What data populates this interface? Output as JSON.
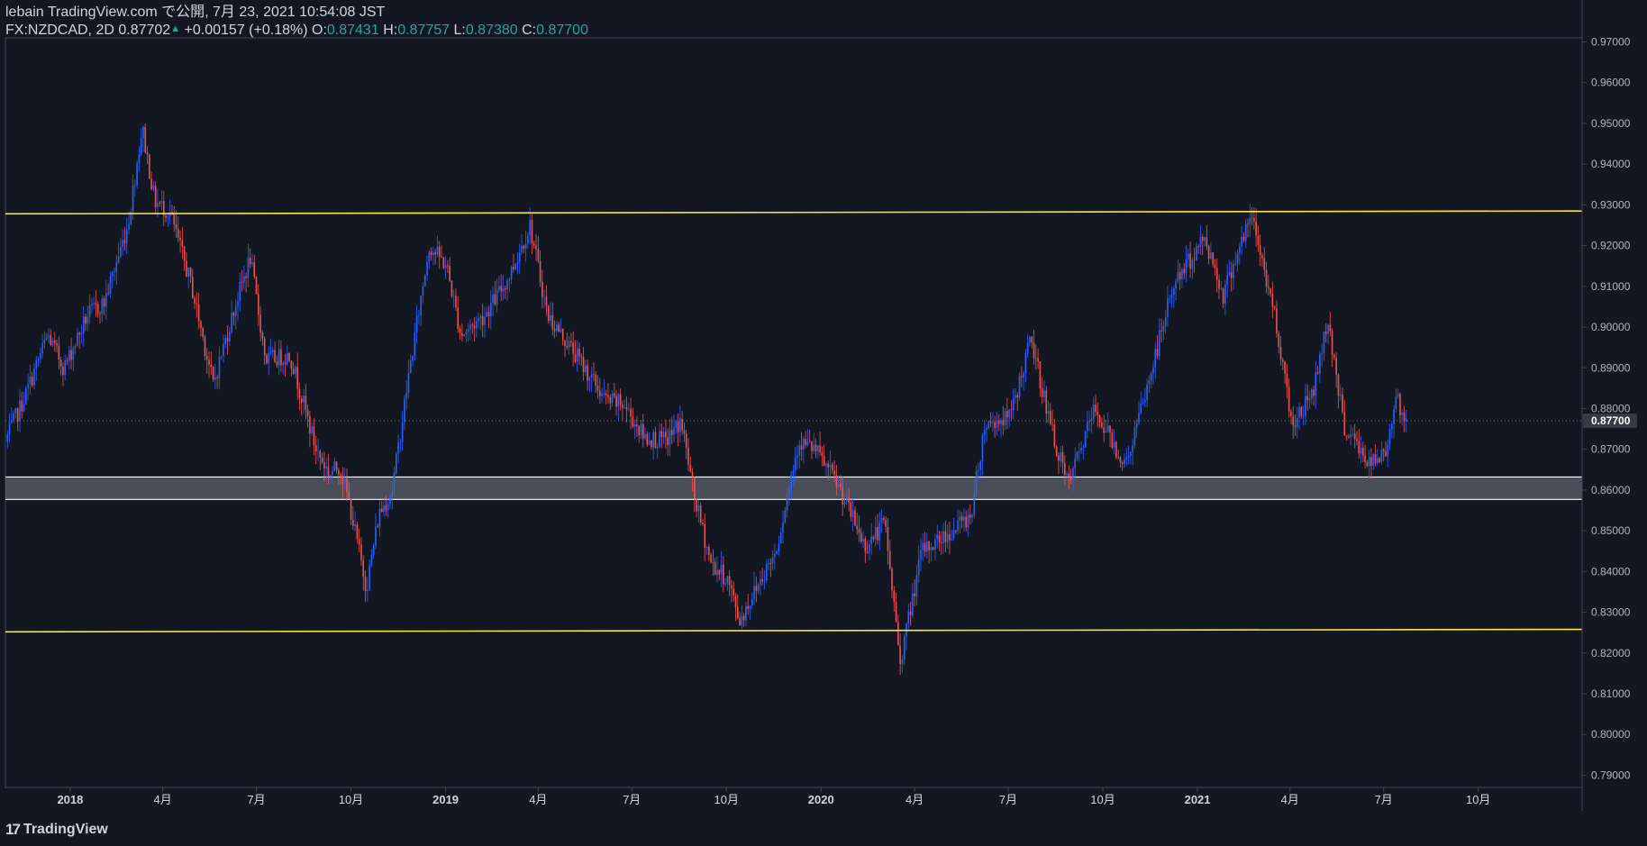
{
  "header": {
    "published": "lebain TradingView.com で公開, 7月 23, 2021 10:54:08 JST",
    "symbol": "FX:NZDCAD, 2D",
    "last": "0.87702",
    "change": "+0.00157 (+0.18%)",
    "o_label": "O:",
    "o_value": "0.87431",
    "h_label": "H:",
    "h_value": "0.87757",
    "l_label": "L:",
    "l_value": "0.87380",
    "c_label": "C:",
    "c_value": "0.87700"
  },
  "footer": {
    "brand": "TradingView",
    "logo_icon": "tradingview-logo-icon"
  },
  "colors": {
    "background": "#131722",
    "up": "#2962ff",
    "down": "#ef5350",
    "level_line": "#f5e643",
    "zone_fill": "#787b86",
    "zone_border": "#ffffff",
    "axis_text": "#b2b5be",
    "last_price_bg": "#363a45"
  },
  "chart_data": {
    "type": "candlestick",
    "ylim": [
      0.787,
      0.971
    ],
    "y_ticks": [
      "0.97000",
      "0.96000",
      "0.95000",
      "0.94000",
      "0.93000",
      "0.92000",
      "0.91000",
      "0.90000",
      "0.89000",
      "0.88000",
      "0.87000",
      "0.86000",
      "0.85000",
      "0.84000",
      "0.83000",
      "0.82000",
      "0.81000",
      "0.80000",
      "0.79000"
    ],
    "x_ticks": [
      {
        "label": "2018",
        "bold": true,
        "date": "2018-01-01"
      },
      {
        "label": "4月",
        "bold": false,
        "date": "2018-04-01"
      },
      {
        "label": "7月",
        "bold": false,
        "date": "2018-07-01"
      },
      {
        "label": "10月",
        "bold": false,
        "date": "2018-10-01"
      },
      {
        "label": "2019",
        "bold": true,
        "date": "2019-01-01"
      },
      {
        "label": "4月",
        "bold": false,
        "date": "2019-04-01"
      },
      {
        "label": "7月",
        "bold": false,
        "date": "2019-07-01"
      },
      {
        "label": "10月",
        "bold": false,
        "date": "2019-10-01"
      },
      {
        "label": "2020",
        "bold": true,
        "date": "2020-01-01"
      },
      {
        "label": "4月",
        "bold": false,
        "date": "2020-04-01"
      },
      {
        "label": "7月",
        "bold": false,
        "date": "2020-07-01"
      },
      {
        "label": "10月",
        "bold": false,
        "date": "2020-10-01"
      },
      {
        "label": "2021",
        "bold": true,
        "date": "2021-01-01"
      },
      {
        "label": "4月",
        "bold": false,
        "date": "2021-04-01"
      },
      {
        "label": "7月",
        "bold": false,
        "date": "2021-07-01"
      },
      {
        "label": "10月",
        "bold": false,
        "date": "2021-10-01"
      }
    ],
    "x_range": [
      "2017-10-30",
      "2022-01-10"
    ],
    "last_price_label": "0.87700",
    "last_price": 0.877,
    "horizontal_lines": [
      {
        "name": "upper-resistance",
        "start": {
          "date": "2017-10-30",
          "value": 0.9278
        },
        "end": {
          "date": "2022-01-10",
          "value": 0.9285
        }
      },
      {
        "name": "lower-support",
        "start": {
          "date": "2017-10-30",
          "value": 0.8252
        },
        "end": {
          "date": "2022-01-10",
          "value": 0.8258
        }
      }
    ],
    "zone": {
      "top": 0.8632,
      "bottom": 0.8577,
      "start": "2017-10-30",
      "end": "2022-01-10"
    },
    "candles_generated": true,
    "candle_start": "2017-11-01",
    "candle_end": "2021-07-23",
    "candle_interval_days": 2,
    "anchors": [
      {
        "date": "2017-11-01",
        "value": 0.872
      },
      {
        "date": "2017-11-20",
        "value": 0.883
      },
      {
        "date": "2017-12-12",
        "value": 0.898
      },
      {
        "date": "2017-12-28",
        "value": 0.89
      },
      {
        "date": "2018-01-20",
        "value": 0.903
      },
      {
        "date": "2018-02-05",
        "value": 0.906
      },
      {
        "date": "2018-02-28",
        "value": 0.925
      },
      {
        "date": "2018-03-14",
        "value": 0.949
      },
      {
        "date": "2018-03-26",
        "value": 0.931
      },
      {
        "date": "2018-04-10",
        "value": 0.928
      },
      {
        "date": "2018-05-01",
        "value": 0.91
      },
      {
        "date": "2018-05-22",
        "value": 0.886
      },
      {
        "date": "2018-06-12",
        "value": 0.905
      },
      {
        "date": "2018-06-27",
        "value": 0.917
      },
      {
        "date": "2018-07-12",
        "value": 0.892
      },
      {
        "date": "2018-08-05",
        "value": 0.893
      },
      {
        "date": "2018-08-30",
        "value": 0.87
      },
      {
        "date": "2018-09-12",
        "value": 0.864
      },
      {
        "date": "2018-09-22",
        "value": 0.866
      },
      {
        "date": "2018-10-02",
        "value": 0.856
      },
      {
        "date": "2018-10-18",
        "value": 0.836
      },
      {
        "date": "2018-10-30",
        "value": 0.854
      },
      {
        "date": "2018-11-12",
        "value": 0.86
      },
      {
        "date": "2018-11-28",
        "value": 0.888
      },
      {
        "date": "2018-12-18",
        "value": 0.92
      },
      {
        "date": "2019-01-04",
        "value": 0.915
      },
      {
        "date": "2019-01-18",
        "value": 0.898
      },
      {
        "date": "2019-02-10",
        "value": 0.903
      },
      {
        "date": "2019-03-05",
        "value": 0.912
      },
      {
        "date": "2019-03-26",
        "value": 0.925
      },
      {
        "date": "2019-04-12",
        "value": 0.903
      },
      {
        "date": "2019-05-10",
        "value": 0.893
      },
      {
        "date": "2019-06-08",
        "value": 0.882
      },
      {
        "date": "2019-06-25",
        "value": 0.881
      },
      {
        "date": "2019-07-15",
        "value": 0.873
      },
      {
        "date": "2019-08-05",
        "value": 0.872
      },
      {
        "date": "2019-08-20",
        "value": 0.877
      },
      {
        "date": "2019-09-02",
        "value": 0.858
      },
      {
        "date": "2019-09-18",
        "value": 0.842
      },
      {
        "date": "2019-10-04",
        "value": 0.838
      },
      {
        "date": "2019-10-16",
        "value": 0.828
      },
      {
        "date": "2019-11-05",
        "value": 0.838
      },
      {
        "date": "2019-11-20",
        "value": 0.845
      },
      {
        "date": "2019-12-12",
        "value": 0.872
      },
      {
        "date": "2019-12-28",
        "value": 0.87
      },
      {
        "date": "2020-01-20",
        "value": 0.861
      },
      {
        "date": "2020-02-15",
        "value": 0.846
      },
      {
        "date": "2020-03-05",
        "value": 0.852
      },
      {
        "date": "2020-03-20",
        "value": 0.818
      },
      {
        "date": "2020-04-10",
        "value": 0.845
      },
      {
        "date": "2020-05-10",
        "value": 0.85
      },
      {
        "date": "2020-05-28",
        "value": 0.854
      },
      {
        "date": "2020-06-10",
        "value": 0.876
      },
      {
        "date": "2020-07-05",
        "value": 0.878
      },
      {
        "date": "2020-07-25",
        "value": 0.897
      },
      {
        "date": "2020-08-15",
        "value": 0.874
      },
      {
        "date": "2020-08-30",
        "value": 0.861
      },
      {
        "date": "2020-09-25",
        "value": 0.88
      },
      {
        "date": "2020-10-25",
        "value": 0.866
      },
      {
        "date": "2020-11-15",
        "value": 0.885
      },
      {
        "date": "2020-12-10",
        "value": 0.91
      },
      {
        "date": "2021-01-10",
        "value": 0.922
      },
      {
        "date": "2021-01-28",
        "value": 0.908
      },
      {
        "date": "2021-02-10",
        "value": 0.918
      },
      {
        "date": "2021-02-25",
        "value": 0.927
      },
      {
        "date": "2021-03-20",
        "value": 0.902
      },
      {
        "date": "2021-04-05",
        "value": 0.876
      },
      {
        "date": "2021-04-25",
        "value": 0.884
      },
      {
        "date": "2021-05-10",
        "value": 0.902
      },
      {
        "date": "2021-05-25",
        "value": 0.876
      },
      {
        "date": "2021-06-20",
        "value": 0.866
      },
      {
        "date": "2021-07-05",
        "value": 0.869
      },
      {
        "date": "2021-07-15",
        "value": 0.884
      },
      {
        "date": "2021-07-23",
        "value": 0.877
      }
    ]
  }
}
